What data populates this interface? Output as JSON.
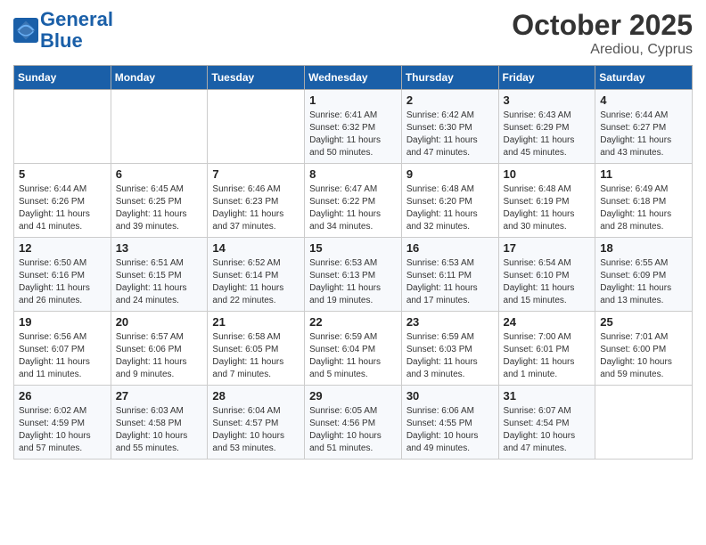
{
  "header": {
    "logo_line1": "General",
    "logo_line2": "Blue",
    "month": "October 2025",
    "location": "Arediou, Cyprus"
  },
  "weekdays": [
    "Sunday",
    "Monday",
    "Tuesday",
    "Wednesday",
    "Thursday",
    "Friday",
    "Saturday"
  ],
  "weeks": [
    [
      {
        "day": "",
        "info": ""
      },
      {
        "day": "",
        "info": ""
      },
      {
        "day": "",
        "info": ""
      },
      {
        "day": "1",
        "info": "Sunrise: 6:41 AM\nSunset: 6:32 PM\nDaylight: 11 hours\nand 50 minutes."
      },
      {
        "day": "2",
        "info": "Sunrise: 6:42 AM\nSunset: 6:30 PM\nDaylight: 11 hours\nand 47 minutes."
      },
      {
        "day": "3",
        "info": "Sunrise: 6:43 AM\nSunset: 6:29 PM\nDaylight: 11 hours\nand 45 minutes."
      },
      {
        "day": "4",
        "info": "Sunrise: 6:44 AM\nSunset: 6:27 PM\nDaylight: 11 hours\nand 43 minutes."
      }
    ],
    [
      {
        "day": "5",
        "info": "Sunrise: 6:44 AM\nSunset: 6:26 PM\nDaylight: 11 hours\nand 41 minutes."
      },
      {
        "day": "6",
        "info": "Sunrise: 6:45 AM\nSunset: 6:25 PM\nDaylight: 11 hours\nand 39 minutes."
      },
      {
        "day": "7",
        "info": "Sunrise: 6:46 AM\nSunset: 6:23 PM\nDaylight: 11 hours\nand 37 minutes."
      },
      {
        "day": "8",
        "info": "Sunrise: 6:47 AM\nSunset: 6:22 PM\nDaylight: 11 hours\nand 34 minutes."
      },
      {
        "day": "9",
        "info": "Sunrise: 6:48 AM\nSunset: 6:20 PM\nDaylight: 11 hours\nand 32 minutes."
      },
      {
        "day": "10",
        "info": "Sunrise: 6:48 AM\nSunset: 6:19 PM\nDaylight: 11 hours\nand 30 minutes."
      },
      {
        "day": "11",
        "info": "Sunrise: 6:49 AM\nSunset: 6:18 PM\nDaylight: 11 hours\nand 28 minutes."
      }
    ],
    [
      {
        "day": "12",
        "info": "Sunrise: 6:50 AM\nSunset: 6:16 PM\nDaylight: 11 hours\nand 26 minutes."
      },
      {
        "day": "13",
        "info": "Sunrise: 6:51 AM\nSunset: 6:15 PM\nDaylight: 11 hours\nand 24 minutes."
      },
      {
        "day": "14",
        "info": "Sunrise: 6:52 AM\nSunset: 6:14 PM\nDaylight: 11 hours\nand 22 minutes."
      },
      {
        "day": "15",
        "info": "Sunrise: 6:53 AM\nSunset: 6:13 PM\nDaylight: 11 hours\nand 19 minutes."
      },
      {
        "day": "16",
        "info": "Sunrise: 6:53 AM\nSunset: 6:11 PM\nDaylight: 11 hours\nand 17 minutes."
      },
      {
        "day": "17",
        "info": "Sunrise: 6:54 AM\nSunset: 6:10 PM\nDaylight: 11 hours\nand 15 minutes."
      },
      {
        "day": "18",
        "info": "Sunrise: 6:55 AM\nSunset: 6:09 PM\nDaylight: 11 hours\nand 13 minutes."
      }
    ],
    [
      {
        "day": "19",
        "info": "Sunrise: 6:56 AM\nSunset: 6:07 PM\nDaylight: 11 hours\nand 11 minutes."
      },
      {
        "day": "20",
        "info": "Sunrise: 6:57 AM\nSunset: 6:06 PM\nDaylight: 11 hours\nand 9 minutes."
      },
      {
        "day": "21",
        "info": "Sunrise: 6:58 AM\nSunset: 6:05 PM\nDaylight: 11 hours\nand 7 minutes."
      },
      {
        "day": "22",
        "info": "Sunrise: 6:59 AM\nSunset: 6:04 PM\nDaylight: 11 hours\nand 5 minutes."
      },
      {
        "day": "23",
        "info": "Sunrise: 6:59 AM\nSunset: 6:03 PM\nDaylight: 11 hours\nand 3 minutes."
      },
      {
        "day": "24",
        "info": "Sunrise: 7:00 AM\nSunset: 6:01 PM\nDaylight: 11 hours\nand 1 minute."
      },
      {
        "day": "25",
        "info": "Sunrise: 7:01 AM\nSunset: 6:00 PM\nDaylight: 10 hours\nand 59 minutes."
      }
    ],
    [
      {
        "day": "26",
        "info": "Sunrise: 6:02 AM\nSunset: 4:59 PM\nDaylight: 10 hours\nand 57 minutes."
      },
      {
        "day": "27",
        "info": "Sunrise: 6:03 AM\nSunset: 4:58 PM\nDaylight: 10 hours\nand 55 minutes."
      },
      {
        "day": "28",
        "info": "Sunrise: 6:04 AM\nSunset: 4:57 PM\nDaylight: 10 hours\nand 53 minutes."
      },
      {
        "day": "29",
        "info": "Sunrise: 6:05 AM\nSunset: 4:56 PM\nDaylight: 10 hours\nand 51 minutes."
      },
      {
        "day": "30",
        "info": "Sunrise: 6:06 AM\nSunset: 4:55 PM\nDaylight: 10 hours\nand 49 minutes."
      },
      {
        "day": "31",
        "info": "Sunrise: 6:07 AM\nSunset: 4:54 PM\nDaylight: 10 hours\nand 47 minutes."
      },
      {
        "day": "",
        "info": ""
      }
    ]
  ]
}
